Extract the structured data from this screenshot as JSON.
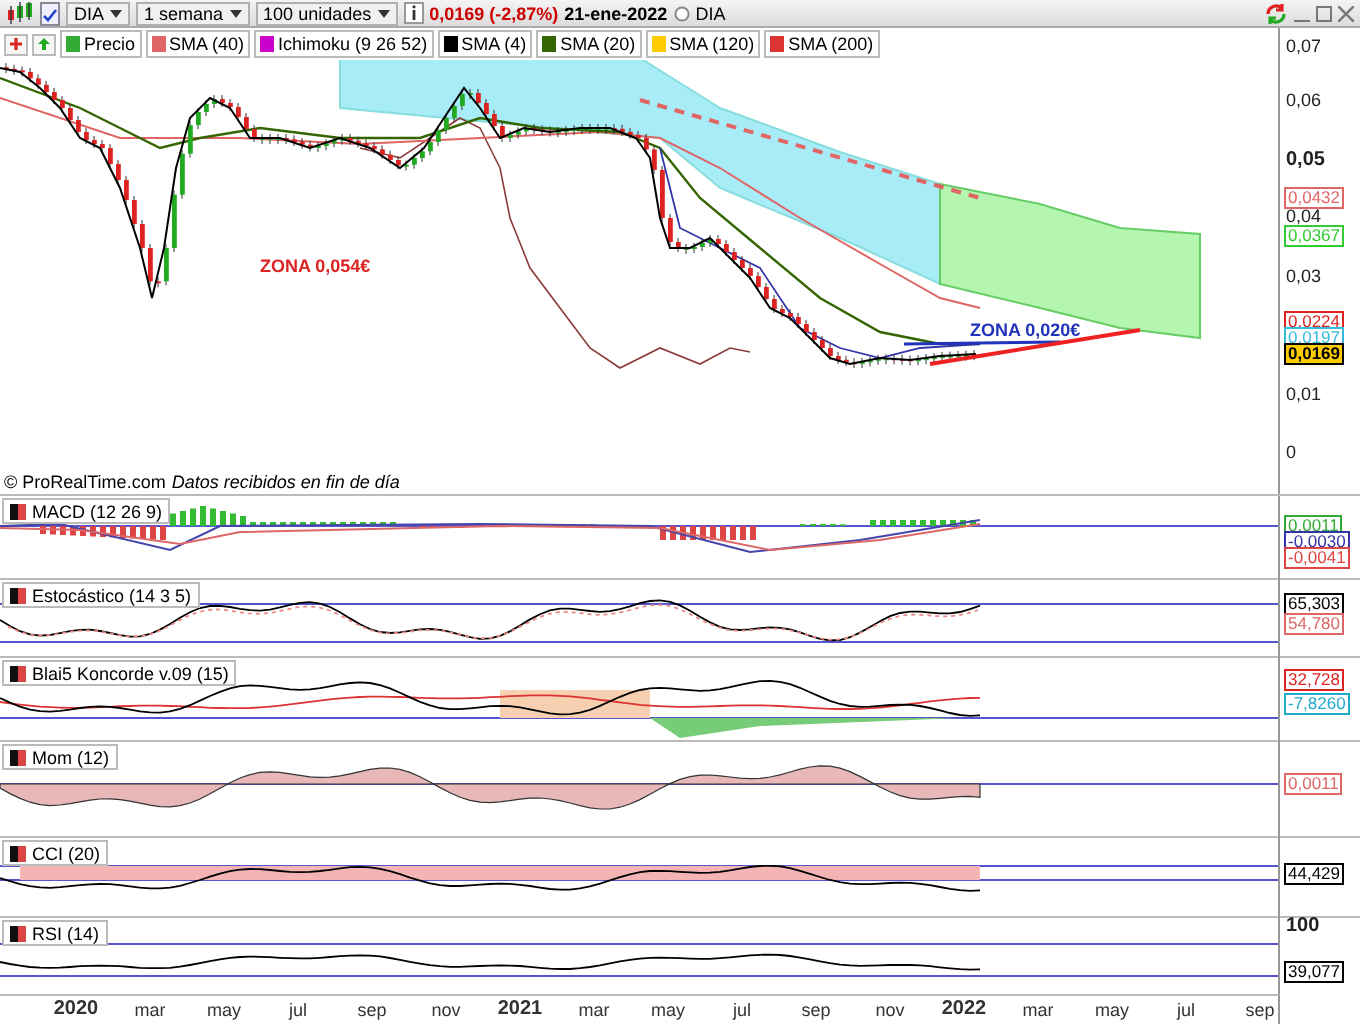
{
  "toolbar": {
    "symbol": "DIA",
    "period": "1 semana",
    "units": "100 unidades",
    "price": "0,0169 (-2,87%)",
    "date": "21-ene-2022",
    "instrument": "DIA"
  },
  "legend": [
    {
      "label": "Precio",
      "color": "#33aa33"
    },
    {
      "label": "SMA (40)",
      "color": "#e06666"
    },
    {
      "label": "Ichimoku (9 26 52)",
      "color": "#cc00cc"
    },
    {
      "label": "SMA (4)",
      "color": "#000000"
    },
    {
      "label": "SMA (20)",
      "color": "#336600"
    },
    {
      "label": "SMA (120)",
      "color": "#ffcc00"
    },
    {
      "label": "SMA (200)",
      "color": "#dd3333"
    }
  ],
  "price_chart": {
    "axis_labels": [
      {
        "text": "0,07",
        "kind": "minor"
      },
      {
        "text": "0,06",
        "kind": "minor"
      },
      {
        "text": "0,05",
        "kind": "major"
      },
      {
        "text": "0,04",
        "kind": "minor"
      },
      {
        "text": "0,03",
        "kind": "minor"
      },
      {
        "text": "0,01",
        "kind": "minor"
      },
      {
        "text": "0",
        "kind": "minor"
      }
    ],
    "value_tags": [
      {
        "text": "0,0432",
        "color": "#e06666",
        "kind": "line"
      },
      {
        "text": "0,0367",
        "color": "#33cc33",
        "kind": "line"
      },
      {
        "text": "0,0224",
        "color": "#dd2222",
        "kind": "line"
      },
      {
        "text": "0,0197",
        "color": "#33bbdd",
        "kind": "line"
      },
      {
        "text": "0,0169",
        "color": "#000000",
        "kind": "current"
      }
    ],
    "annotations": [
      {
        "text": "ZONA 0,054€",
        "color": "#dd2222"
      },
      {
        "text": "ZONA 0,020€",
        "color": "#2233bb"
      }
    ]
  },
  "attribution": {
    "source": "© ProRealTime.com",
    "note": "Datos recibidos en fin de día"
  },
  "panels": [
    {
      "kind": "macd",
      "title": "MACD (12 26 9)",
      "value_tags": [
        {
          "text": "0,0011",
          "color": "#33aa33"
        },
        {
          "text": "-0,0030",
          "color": "#3333aa"
        },
        {
          "text": "-0,0041",
          "color": "#dd4444"
        }
      ]
    },
    {
      "kind": "stochastic",
      "title": "Estocástico (14 3 5)",
      "value_tags": [
        {
          "text": "65,303",
          "color": "#000000"
        },
        {
          "text": "54,780",
          "color": "#dd6666"
        }
      ]
    },
    {
      "kind": "koncorde",
      "title": "Blai5 Koncorde v.09 (15)",
      "value_tags": [
        {
          "text": "32,728",
          "color": "#dd2222"
        },
        {
          "text": "-7,8260",
          "color": "#22aacc"
        }
      ]
    },
    {
      "kind": "momentum",
      "title": "Mom (12)",
      "value_tags": [
        {
          "text": "0,0011",
          "color": "#dd6666"
        }
      ]
    },
    {
      "kind": "cci",
      "title": "CCI (20)",
      "value_tags": [
        {
          "text": "44,429",
          "color": "#000000"
        }
      ]
    },
    {
      "kind": "rsi",
      "title": "RSI (14)",
      "axis_labels": [
        "100"
      ],
      "value_tags": [
        {
          "text": "39,077",
          "color": "#000000"
        }
      ]
    }
  ],
  "time_axis": [
    {
      "text": "2020",
      "kind": "year"
    },
    {
      "text": "mar",
      "kind": "month"
    },
    {
      "text": "may",
      "kind": "month"
    },
    {
      "text": "jul",
      "kind": "month"
    },
    {
      "text": "sep",
      "kind": "month"
    },
    {
      "text": "nov",
      "kind": "month"
    },
    {
      "text": "2021",
      "kind": "year"
    },
    {
      "text": "mar",
      "kind": "month"
    },
    {
      "text": "may",
      "kind": "month"
    },
    {
      "text": "jul",
      "kind": "month"
    },
    {
      "text": "sep",
      "kind": "month"
    },
    {
      "text": "nov",
      "kind": "month"
    },
    {
      "text": "2022",
      "kind": "year"
    },
    {
      "text": "mar",
      "kind": "month"
    },
    {
      "text": "may",
      "kind": "month"
    },
    {
      "text": "jul",
      "kind": "month"
    },
    {
      "text": "sep",
      "kind": "month"
    }
  ]
}
